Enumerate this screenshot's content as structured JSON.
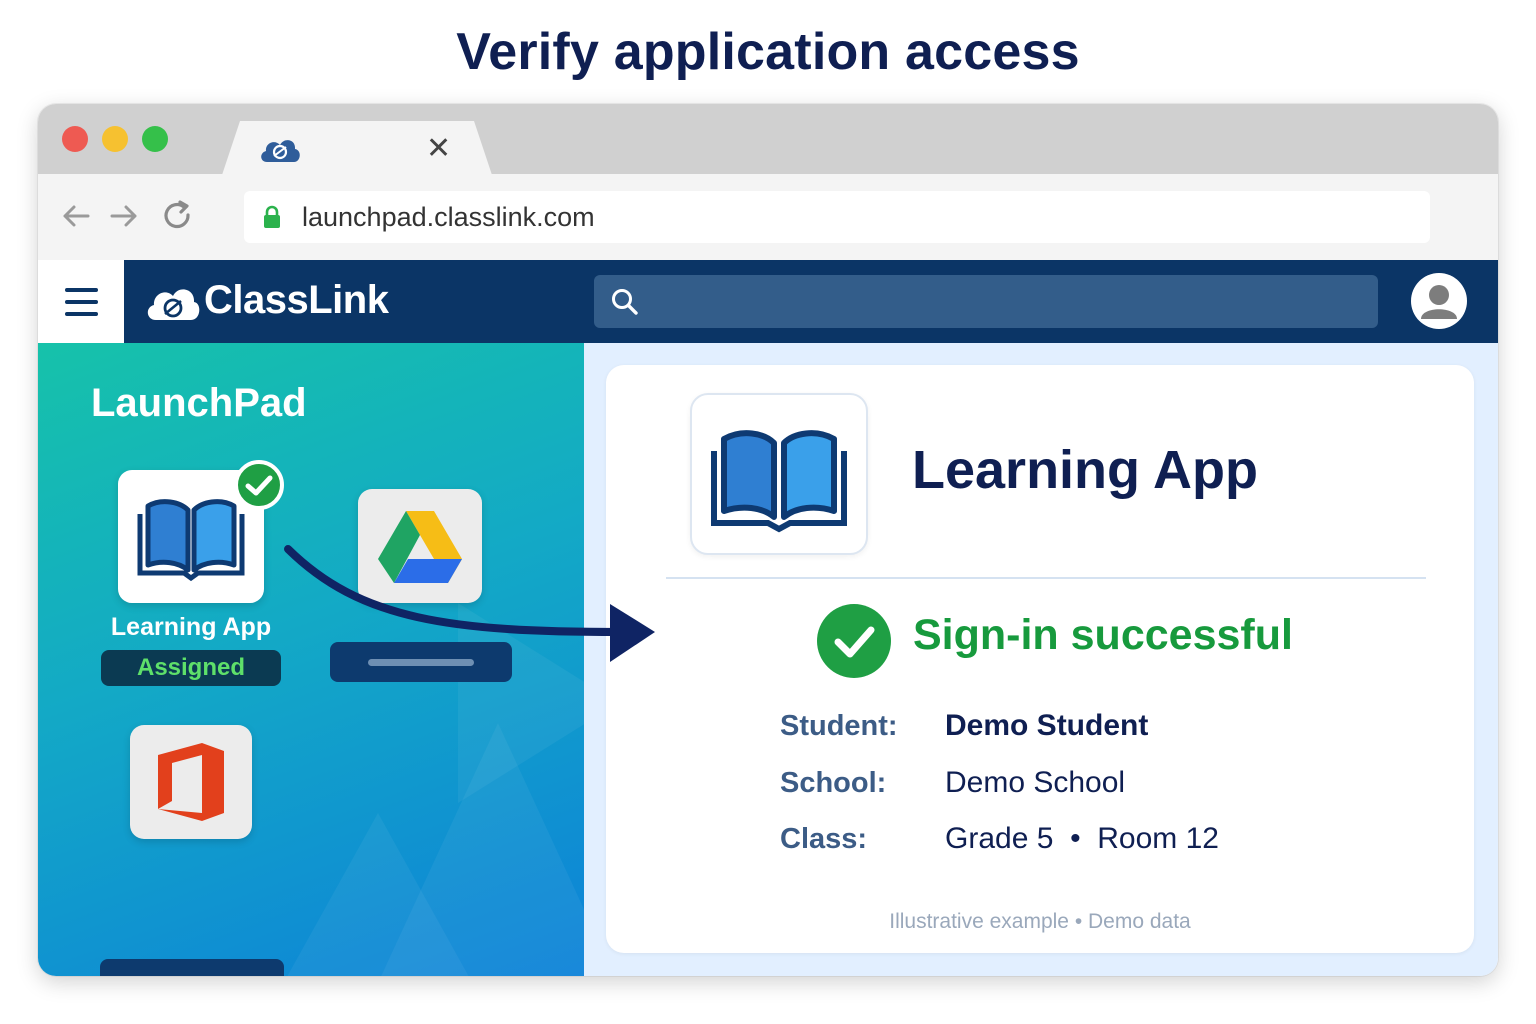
{
  "page": {
    "title": "Verify application access"
  },
  "browser": {
    "tab": {
      "favicon": "classlink-cloud-icon",
      "close_icon": "close-icon",
      "close_glyph": "✕"
    },
    "toolbar": {
      "back_icon": "back-arrow-icon",
      "forward_icon": "forward-arrow-icon",
      "reload_icon": "reload-icon"
    },
    "address_bar": {
      "secure_icon": "lock-icon",
      "url": "launchpad.classlink.com"
    }
  },
  "app_header": {
    "menu_icon": "hamburger-menu-icon",
    "logo_text": "ClassLink",
    "search_icon": "search-icon",
    "search_placeholder": "",
    "avatar_icon": "user-avatar-icon"
  },
  "launchpad": {
    "title": "LaunchPad",
    "apps": [
      {
        "label": "Learning App",
        "badge": "Assigned",
        "icon": "open-book-icon",
        "status_icon": "checkmark-badge-icon"
      },
      {
        "label": "",
        "icon": "google-drive-icon"
      },
      {
        "label": "",
        "icon": "office-icon"
      }
    ]
  },
  "detail": {
    "app_name": "Learning App",
    "app_icon": "open-book-icon",
    "status_icon": "success-check-icon",
    "status": "Sign-in successful",
    "fields": [
      {
        "label": "Student:",
        "value": "Demo Student"
      },
      {
        "label": "School:",
        "value": "Demo School"
      },
      {
        "label": "Class:",
        "value": "Grade 5  •  Room 12"
      }
    ],
    "footnote": "Illustrative example • Demo data"
  },
  "colors": {
    "header_navy": "#0b3566",
    "success_green": "#179a3d",
    "title_navy": "#0f1f52",
    "teal_gradient_start": "#16c2aa",
    "blue_gradient_end": "#0d82d8"
  }
}
